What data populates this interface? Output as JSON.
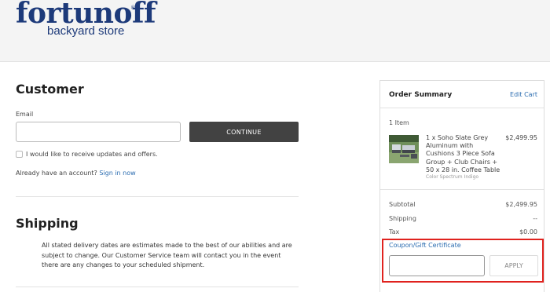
{
  "logo": {
    "main": "fortunoff",
    "sub": "backyard store",
    "reg": "®"
  },
  "customer": {
    "title": "Customer",
    "email_label": "Email",
    "email_value": "",
    "continue_label": "CONTINUE",
    "updates_label": "I would like to receive updates and offers.",
    "account_prefix": "Already have an account?",
    "sign_in_label": "Sign in now"
  },
  "shipping": {
    "title": "Shipping",
    "notice": "All stated delivery dates are estimates made to the best of our abilities and are subject to change. Our Customer Service team will contact you in the event there are any changes to your scheduled shipment."
  },
  "summary": {
    "title": "Order Summary",
    "edit_label": "Edit Cart",
    "item_count": "1 Item",
    "item": {
      "description": "1 x Soho Slate Grey Aluminum with Cushions 3 Piece Sofa Group + Club Chairs + 50 x 28 in. Coffee Table",
      "variant": "Color Spectrum Indigo",
      "price": "$2,499.95"
    },
    "subtotal_label": "Subtotal",
    "subtotal_value": "$2,499.95",
    "shipping_label": "Shipping",
    "shipping_value": "--",
    "tax_label": "Tax",
    "tax_value": "$0.00",
    "coupon_label": "Coupon/Gift Certificate",
    "coupon_value": "",
    "apply_label": "APPLY"
  },
  "colors": {
    "brand": "#1d3a7a",
    "link": "#2b6cb0",
    "button_dark": "#424242",
    "highlight": "#e0221e"
  },
  "icons": {
    "checkbox": "checkbox-icon"
  }
}
